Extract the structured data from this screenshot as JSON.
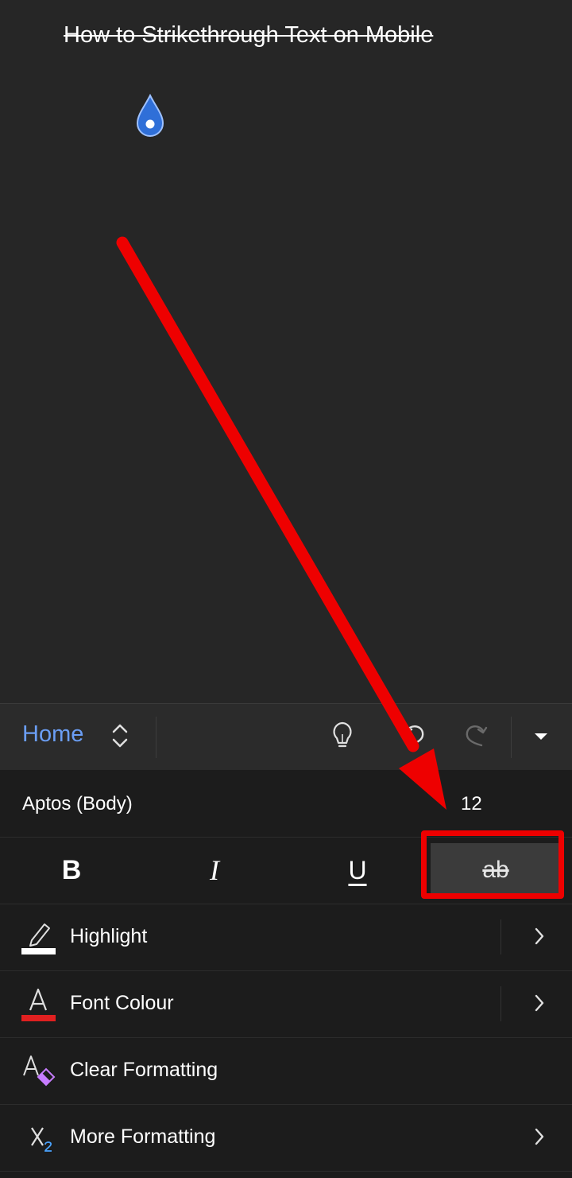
{
  "document": {
    "text": "How to Strikethrough Text on Mobile"
  },
  "ribbon": {
    "tab_label": "Home",
    "icons": [
      "tab-switch-icon",
      "lightbulb-icon",
      "undo-icon",
      "redo-icon",
      "collapse-ribbon-icon"
    ]
  },
  "font": {
    "name": "Aptos (Body)",
    "size": "12"
  },
  "format_buttons": {
    "bold": "B",
    "italic": "I",
    "underline": "U",
    "strikethrough": "ab"
  },
  "list": {
    "highlight": "Highlight",
    "font_colour": "Font Colour",
    "clear_formatting": "Clear Formatting",
    "more_formatting": "More Formatting"
  },
  "colors": {
    "accent": "#6b9ef5",
    "annotation": "#ee0000",
    "font_colour_bar": "#e02020",
    "clear_icon_accent": "#c77dff"
  }
}
